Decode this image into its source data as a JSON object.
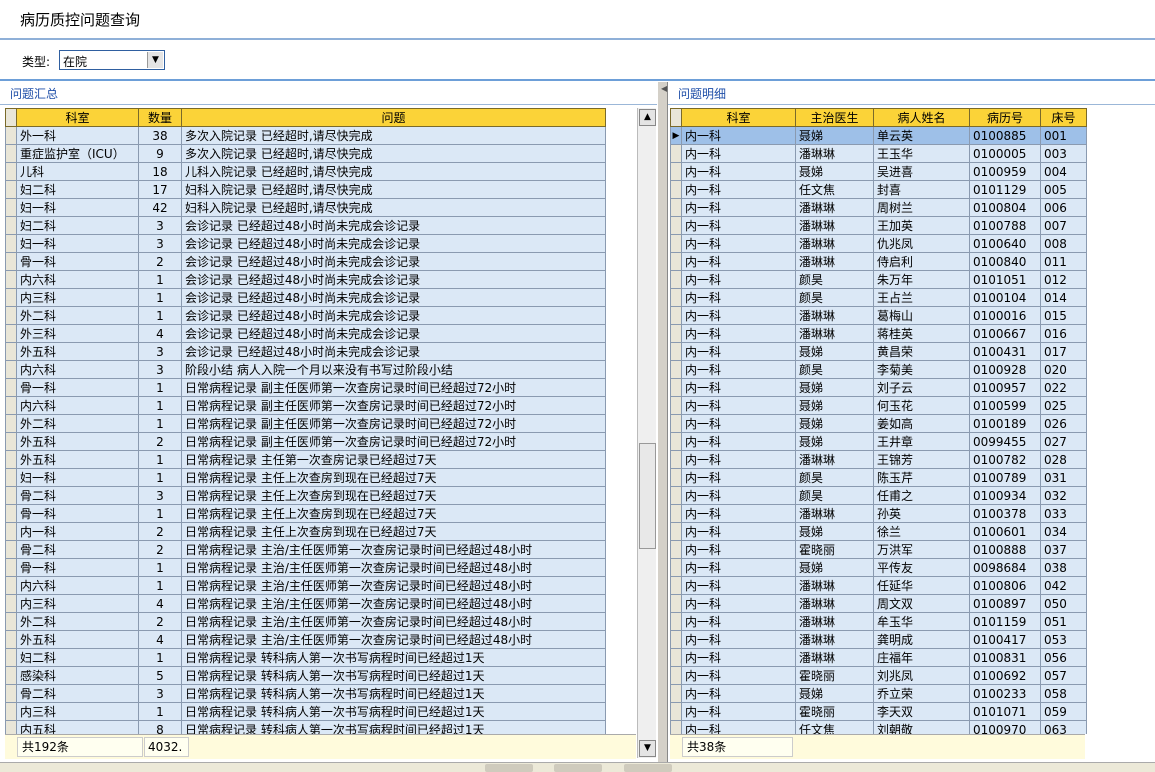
{
  "title": "病历质控问题查询",
  "filter": {
    "label": "类型:",
    "value": "在院"
  },
  "left_panel": {
    "title": "问题汇总",
    "columns": [
      "科室",
      "数量",
      "问题"
    ],
    "rows": [
      [
        "外一科",
        "38",
        "多次入院记录 已经超时,请尽快完成"
      ],
      [
        "重症监护室（ICU）",
        "9",
        "多次入院记录 已经超时,请尽快完成"
      ],
      [
        "儿科",
        "18",
        "儿科入院记录 已经超时,请尽快完成"
      ],
      [
        "妇二科",
        "17",
        "妇科入院记录 已经超时,请尽快完成"
      ],
      [
        "妇一科",
        "42",
        "妇科入院记录 已经超时,请尽快完成"
      ],
      [
        "妇二科",
        "3",
        "会诊记录 已经超过48小时尚未完成会诊记录"
      ],
      [
        "妇一科",
        "3",
        "会诊记录 已经超过48小时尚未完成会诊记录"
      ],
      [
        "骨一科",
        "2",
        "会诊记录 已经超过48小时尚未完成会诊记录"
      ],
      [
        "内六科",
        "1",
        "会诊记录 已经超过48小时尚未完成会诊记录"
      ],
      [
        "内三科",
        "1",
        "会诊记录 已经超过48小时尚未完成会诊记录"
      ],
      [
        "外二科",
        "1",
        "会诊记录 已经超过48小时尚未完成会诊记录"
      ],
      [
        "外三科",
        "4",
        "会诊记录 已经超过48小时尚未完成会诊记录"
      ],
      [
        "外五科",
        "3",
        "会诊记录 已经超过48小时尚未完成会诊记录"
      ],
      [
        "内六科",
        "3",
        "阶段小结 病人入院一个月以来没有书写过阶段小结"
      ],
      [
        "骨一科",
        "1",
        "日常病程记录 副主任医师第一次查房记录时间已经超过72小时"
      ],
      [
        "内六科",
        "1",
        "日常病程记录 副主任医师第一次查房记录时间已经超过72小时"
      ],
      [
        "外二科",
        "1",
        "日常病程记录 副主任医师第一次查房记录时间已经超过72小时"
      ],
      [
        "外五科",
        "2",
        "日常病程记录 副主任医师第一次查房记录时间已经超过72小时"
      ],
      [
        "外五科",
        "1",
        "日常病程记录 主任第一次查房记录已经超过7天"
      ],
      [
        "妇一科",
        "1",
        "日常病程记录 主任上次查房到现在已经超过7天"
      ],
      [
        "骨二科",
        "3",
        "日常病程记录 主任上次查房到现在已经超过7天"
      ],
      [
        "骨一科",
        "1",
        "日常病程记录 主任上次查房到现在已经超过7天"
      ],
      [
        "内一科",
        "2",
        "日常病程记录 主任上次查房到现在已经超过7天"
      ],
      [
        "骨二科",
        "2",
        "日常病程记录 主治/主任医师第一次查房记录时间已经超过48小时"
      ],
      [
        "骨一科",
        "1",
        "日常病程记录 主治/主任医师第一次查房记录时间已经超过48小时"
      ],
      [
        "内六科",
        "1",
        "日常病程记录 主治/主任医师第一次查房记录时间已经超过48小时"
      ],
      [
        "内三科",
        "4",
        "日常病程记录 主治/主任医师第一次查房记录时间已经超过48小时"
      ],
      [
        "外二科",
        "2",
        "日常病程记录 主治/主任医师第一次查房记录时间已经超过48小时"
      ],
      [
        "外五科",
        "4",
        "日常病程记录 主治/主任医师第一次查房记录时间已经超过48小时"
      ],
      [
        "妇二科",
        "1",
        "日常病程记录 转科病人第一次书写病程时间已经超过1天"
      ],
      [
        "感染科",
        "5",
        "日常病程记录 转科病人第一次书写病程时间已经超过1天"
      ],
      [
        "骨二科",
        "3",
        "日常病程记录 转科病人第一次书写病程时间已经超过1天"
      ],
      [
        "内三科",
        "1",
        "日常病程记录 转科病人第一次书写病程时间已经超过1天"
      ],
      [
        "内五科",
        "8",
        "日常病程记录 转科病人第一次书写病程时间已经超过1天"
      ]
    ],
    "footer_count": "共192条",
    "footer_sum": "4032."
  },
  "right_panel": {
    "title": "问题明细",
    "columns": [
      "科室",
      "主治医生",
      "病人姓名",
      "病历号",
      "床号"
    ],
    "rows": [
      [
        "内一科",
        "聂娣",
        "单云英",
        "0100885",
        "001"
      ],
      [
        "内一科",
        "潘琳琳",
        "王玉华",
        "0100005",
        "003"
      ],
      [
        "内一科",
        "聂娣",
        "吴进喜",
        "0100959",
        "004"
      ],
      [
        "内一科",
        "任文焦",
        "封喜",
        "0101129",
        "005"
      ],
      [
        "内一科",
        "潘琳琳",
        "周树兰",
        "0100804",
        "006"
      ],
      [
        "内一科",
        "潘琳琳",
        "王加英",
        "0100788",
        "007"
      ],
      [
        "内一科",
        "潘琳琳",
        "仇兆凤",
        "0100640",
        "008"
      ],
      [
        "内一科",
        "潘琳琳",
        "侍启利",
        "0100840",
        "011"
      ],
      [
        "内一科",
        "颜昊",
        "朱万年",
        "0101051",
        "012"
      ],
      [
        "内一科",
        "颜昊",
        "王占兰",
        "0100104",
        "014"
      ],
      [
        "内一科",
        "潘琳琳",
        "葛梅山",
        "0100016",
        "015"
      ],
      [
        "内一科",
        "潘琳琳",
        "蒋桂英",
        "0100667",
        "016"
      ],
      [
        "内一科",
        "聂娣",
        "黄昌荣",
        "0100431",
        "017"
      ],
      [
        "内一科",
        "颜昊",
        "李菊美",
        "0100928",
        "020"
      ],
      [
        "内一科",
        "聂娣",
        "刘子云",
        "0100957",
        "022"
      ],
      [
        "内一科",
        "聂娣",
        "何玉花",
        "0100599",
        "025"
      ],
      [
        "内一科",
        "聂娣",
        "姜如高",
        "0100189",
        "026"
      ],
      [
        "内一科",
        "聂娣",
        "王井章",
        "0099455",
        "027"
      ],
      [
        "内一科",
        "潘琳琳",
        "王锦芳",
        "0100782",
        "028"
      ],
      [
        "内一科",
        "颜昊",
        "陈玉芹",
        "0100789",
        "031"
      ],
      [
        "内一科",
        "颜昊",
        "任甫之",
        "0100934",
        "032"
      ],
      [
        "内一科",
        "潘琳琳",
        "孙英",
        "0100378",
        "033"
      ],
      [
        "内一科",
        "聂娣",
        "徐兰",
        "0100601",
        "034"
      ],
      [
        "内一科",
        "霍晓丽",
        "万洪军",
        "0100888",
        "037"
      ],
      [
        "内一科",
        "聂娣",
        "平传友",
        "0098684",
        "038"
      ],
      [
        "内一科",
        "潘琳琳",
        "任延华",
        "0100806",
        "042"
      ],
      [
        "内一科",
        "潘琳琳",
        "周文双",
        "0100897",
        "050"
      ],
      [
        "内一科",
        "潘琳琳",
        "牟玉华",
        "0101159",
        "051"
      ],
      [
        "内一科",
        "潘琳琳",
        "龚明成",
        "0100417",
        "053"
      ],
      [
        "内一科",
        "潘琳琳",
        "庄福年",
        "0100831",
        "056"
      ],
      [
        "内一科",
        "霍晓丽",
        "刘兆凤",
        "0100692",
        "057"
      ],
      [
        "内一科",
        "聂娣",
        "乔立荣",
        "0100233",
        "058"
      ],
      [
        "内一科",
        "霍晓丽",
        "李天双",
        "0101071",
        "059"
      ],
      [
        "内一科",
        "任文焦",
        "刘朝敬",
        "0100970",
        "063"
      ]
    ],
    "footer_count": "共38条"
  }
}
